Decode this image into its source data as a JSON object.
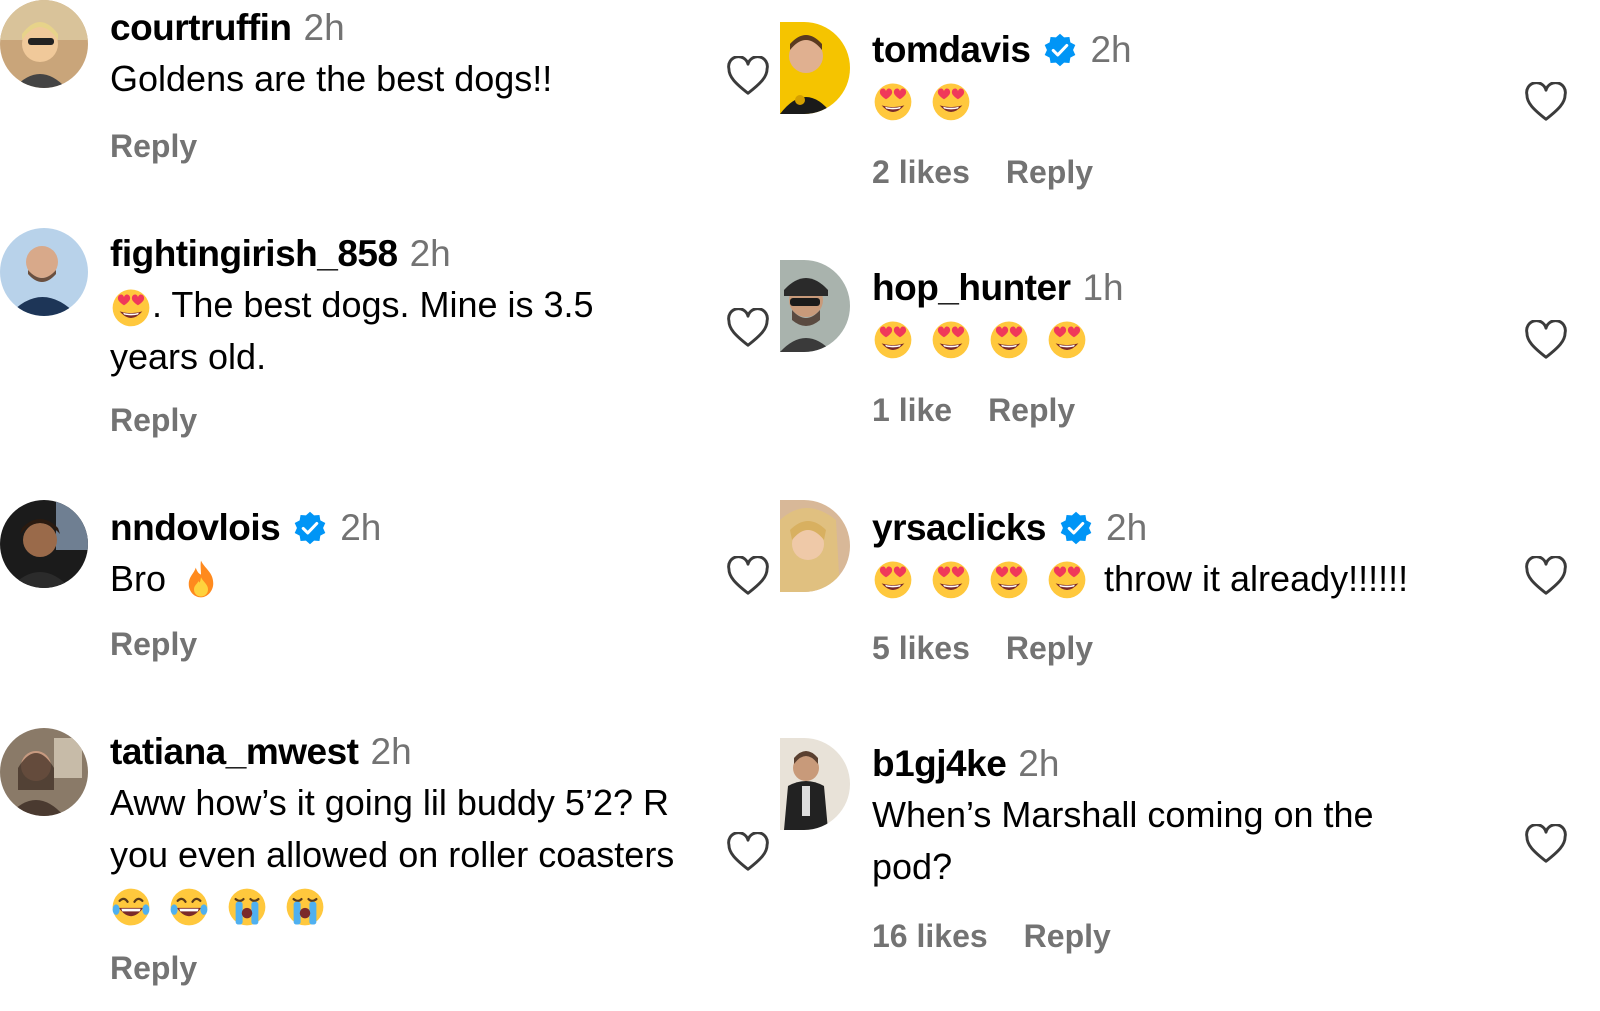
{
  "left_comments": [
    {
      "username": "courtruffin",
      "time": "2h",
      "text": "Goldens are the best dogs!!",
      "reply": "Reply"
    },
    {
      "username": "fightingirish_858",
      "time": "2h",
      "text_after_emoji": ". The best dogs. Mine is 3.5",
      "text_line2": "years old.",
      "reply": "Reply"
    },
    {
      "username": "nndovlois",
      "time": "2h",
      "text": "Bro",
      "reply": "Reply"
    },
    {
      "username": "tatiana_mwest",
      "time": "2h",
      "text_line1": "Aww how’s it going lil buddy 5’2? R",
      "text_line2": "you even allowed on roller coasters",
      "reply": "Reply"
    }
  ],
  "right_comments": [
    {
      "username": "tomdavis",
      "time": "2h",
      "likes": "2 likes",
      "reply": "Reply"
    },
    {
      "username": "hop_hunter",
      "time": "1h",
      "likes": "1 like",
      "reply": "Reply"
    },
    {
      "username": "yrsaclicks",
      "time": "2h",
      "text_after_emojis": "throw it already!!!!!!",
      "likes": "5 likes",
      "reply": "Reply"
    },
    {
      "username": "b1gj4ke",
      "time": "2h",
      "text_line1": "When’s Marshall coming on the",
      "text_line2": "pod?",
      "likes": "16 likes",
      "reply": "Reply"
    }
  ],
  "colors": {
    "verified": "#0095f6",
    "muted": "#737373",
    "emoji_face": "#ffc83d",
    "emoji_heart": "#f0385a"
  },
  "icons": [
    "heart-outline-icon",
    "verified-badge-icon",
    "heart-eyes-emoji",
    "fire-emoji",
    "laughing-emoji",
    "crying-emoji"
  ]
}
